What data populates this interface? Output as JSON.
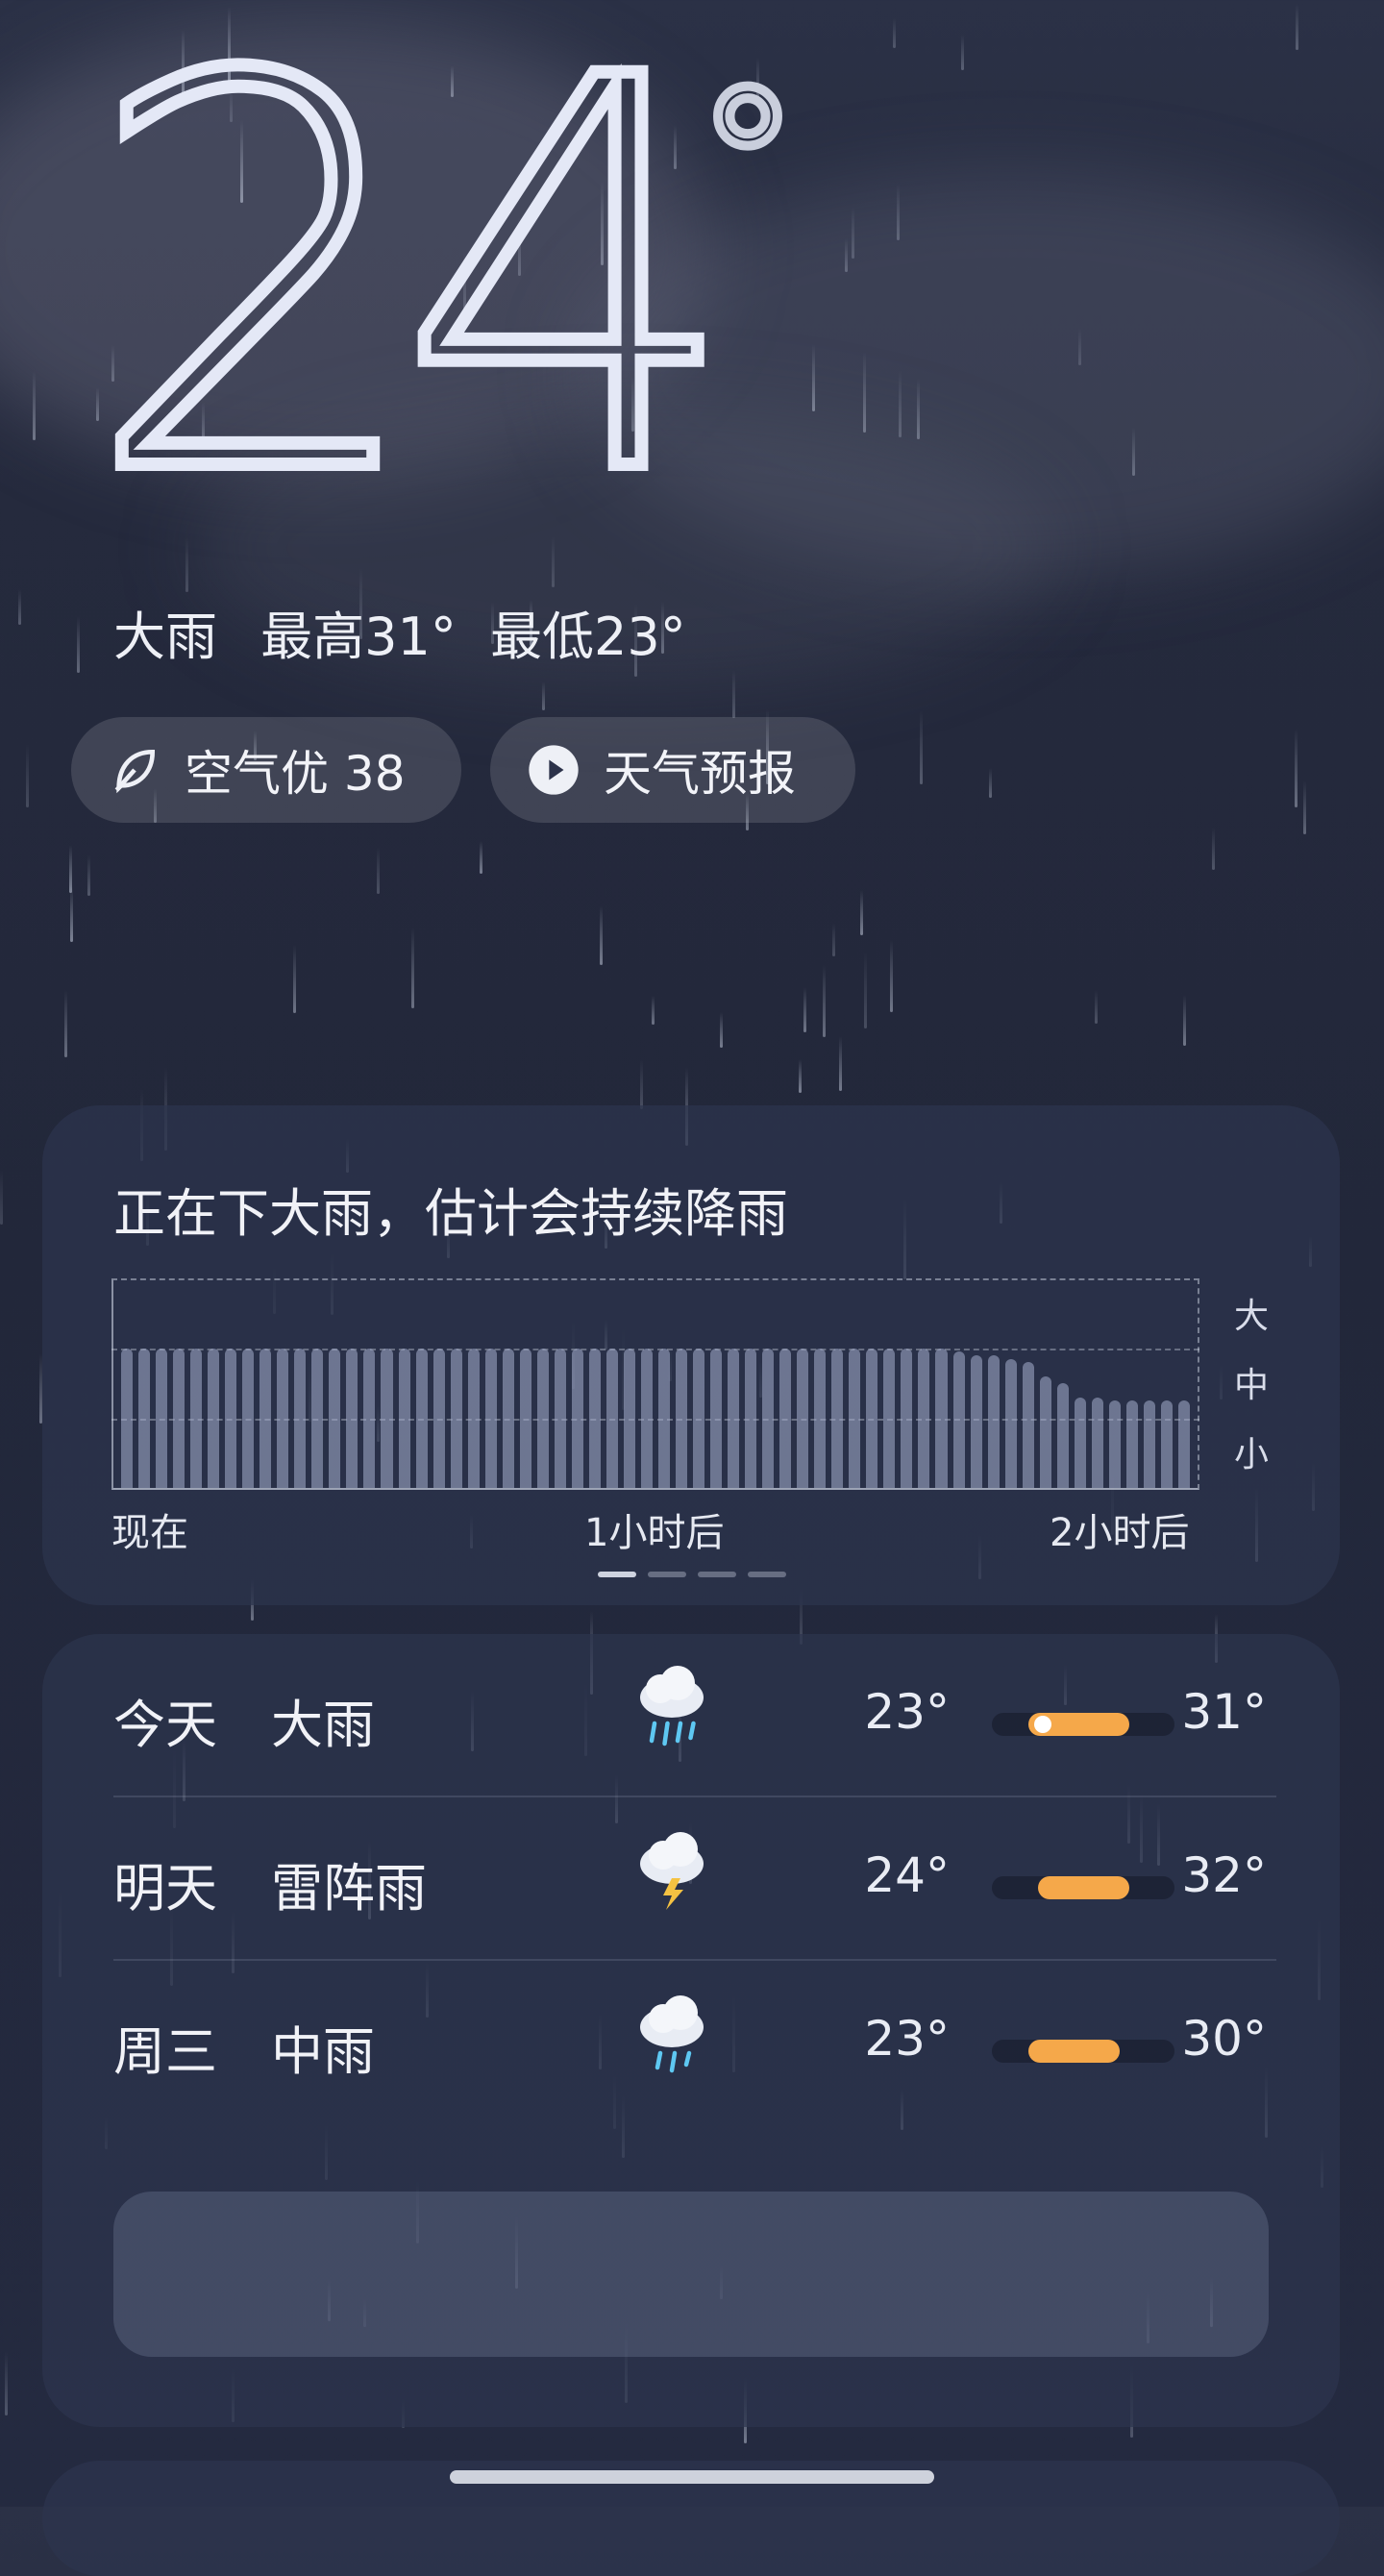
{
  "current": {
    "temperature": "24",
    "degree": "°",
    "condition": "大雨",
    "high": "最高31°",
    "low": "最低23°"
  },
  "pills": {
    "air_quality": "空气优 38",
    "forecast_video": "天气预报"
  },
  "precip_card": {
    "title": "正在下大雨，估计会持续降雨",
    "levels": [
      "大",
      "中",
      "小"
    ],
    "time_labels": [
      "现在",
      "1小时后",
      "2小时后"
    ],
    "pager": {
      "count": 4,
      "active": 0
    },
    "chart_data": {
      "type": "bar",
      "title": "",
      "xlabel": "",
      "ylabel": "",
      "x_ticks": [
        "现在",
        "1小时后",
        "2小时后"
      ],
      "y_ticks": [
        "小",
        "中",
        "大"
      ],
      "ylim": [
        0,
        3
      ],
      "values": [
        2.0,
        2.0,
        2.0,
        2.0,
        2.0,
        2.0,
        2.0,
        2.0,
        2.0,
        2.0,
        2.0,
        2.0,
        2.0,
        2.0,
        2.0,
        2.0,
        2.0,
        2.0,
        2.0,
        2.0,
        2.0,
        2.0,
        2.0,
        2.0,
        2.0,
        2.0,
        2.0,
        2.0,
        2.0,
        2.0,
        2.0,
        2.0,
        2.0,
        2.0,
        2.0,
        2.0,
        2.0,
        2.0,
        2.0,
        2.0,
        2.0,
        2.0,
        2.0,
        2.0,
        2.0,
        2.0,
        2.0,
        2.0,
        1.95,
        1.9,
        1.9,
        1.85,
        1.8,
        1.6,
        1.5,
        1.3,
        1.3,
        1.25,
        1.25,
        1.25,
        1.25,
        1.25
      ]
    }
  },
  "daily": [
    {
      "day": "今天",
      "condition": "大雨",
      "icon": "heavy-rain-icon",
      "low": "23°",
      "high": "31°",
      "range_start": 0.2,
      "range_end": 0.75,
      "now": 0.28
    },
    {
      "day": "明天",
      "condition": "雷阵雨",
      "icon": "thunderstorm-icon",
      "low": "24°",
      "high": "32°",
      "range_start": 0.25,
      "range_end": 0.75,
      "now": null
    },
    {
      "day": "周三",
      "condition": "中雨",
      "icon": "moderate-rain-icon",
      "low": "23°",
      "high": "30°",
      "range_start": 0.2,
      "range_end": 0.7,
      "now": null
    }
  ],
  "colors": {
    "background": "#242a3e",
    "card": "#2c344e",
    "range_fill": "#f5a84a"
  }
}
